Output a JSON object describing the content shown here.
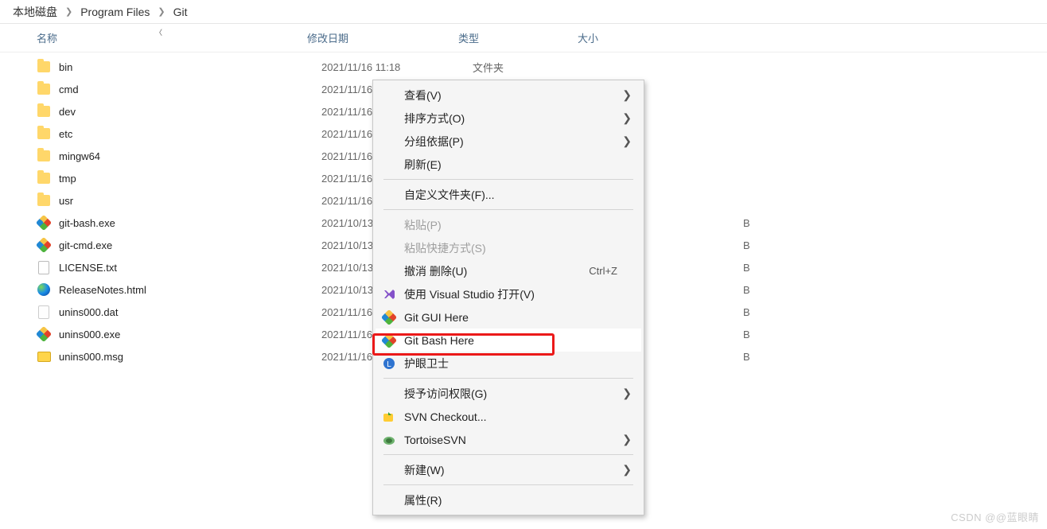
{
  "breadcrumb": {
    "seg1": "本地磁盘",
    "seg2": "Program Files",
    "seg3": "Git"
  },
  "columns": {
    "name": "名称",
    "date": "修改日期",
    "type": "类型",
    "size": "大小"
  },
  "rows": [
    {
      "icon": "folder",
      "name": "bin",
      "date": "2021/11/16 11:18",
      "type_partial": "文件夹"
    },
    {
      "icon": "folder",
      "name": "cmd",
      "date": "2021/11/16"
    },
    {
      "icon": "folder",
      "name": "dev",
      "date": "2021/11/16"
    },
    {
      "icon": "folder",
      "name": "etc",
      "date": "2021/11/16"
    },
    {
      "icon": "folder",
      "name": "mingw64",
      "date": "2021/11/16"
    },
    {
      "icon": "folder",
      "name": "tmp",
      "date": "2021/11/16"
    },
    {
      "icon": "folder",
      "name": "usr",
      "date": "2021/11/16"
    },
    {
      "icon": "git",
      "name": "git-bash.exe",
      "date": "2021/10/13",
      "size_partial": "B"
    },
    {
      "icon": "git",
      "name": "git-cmd.exe",
      "date": "2021/10/13",
      "size_partial": "B"
    },
    {
      "icon": "txt",
      "name": "LICENSE.txt",
      "date": "2021/10/13",
      "size_partial": "B"
    },
    {
      "icon": "edge",
      "name": "ReleaseNotes.html",
      "date": "2021/10/13",
      "size_partial": "B"
    },
    {
      "icon": "dat",
      "name": "unins000.dat",
      "date": "2021/11/16",
      "size_partial": "B"
    },
    {
      "icon": "git",
      "name": "unins000.exe",
      "date": "2021/11/16",
      "size_partial": "B"
    },
    {
      "icon": "msg",
      "name": "unins000.msg",
      "date": "2021/11/16",
      "size_partial": "B"
    }
  ],
  "menu": {
    "view": "查看(V)",
    "sort": "排序方式(O)",
    "group": "分组依据(P)",
    "refresh": "刷新(E)",
    "customize": "自定义文件夹(F)...",
    "paste": "粘贴(P)",
    "paste_shortcut": "粘贴快捷方式(S)",
    "undo": "撤消 删除(U)",
    "undo_short": "Ctrl+Z",
    "vs_open": "使用 Visual Studio 打开(V)",
    "git_gui": "Git GUI Here",
    "git_bash": "Git Bash Here",
    "huyan": "护眼卫士",
    "grant": "授予访问权限(G)",
    "svn_checkout": "SVN Checkout...",
    "tortoise": "TortoiseSVN",
    "new": "新建(W)",
    "properties": "属性(R)"
  },
  "watermark": "CSDN @@蓝眼睛"
}
